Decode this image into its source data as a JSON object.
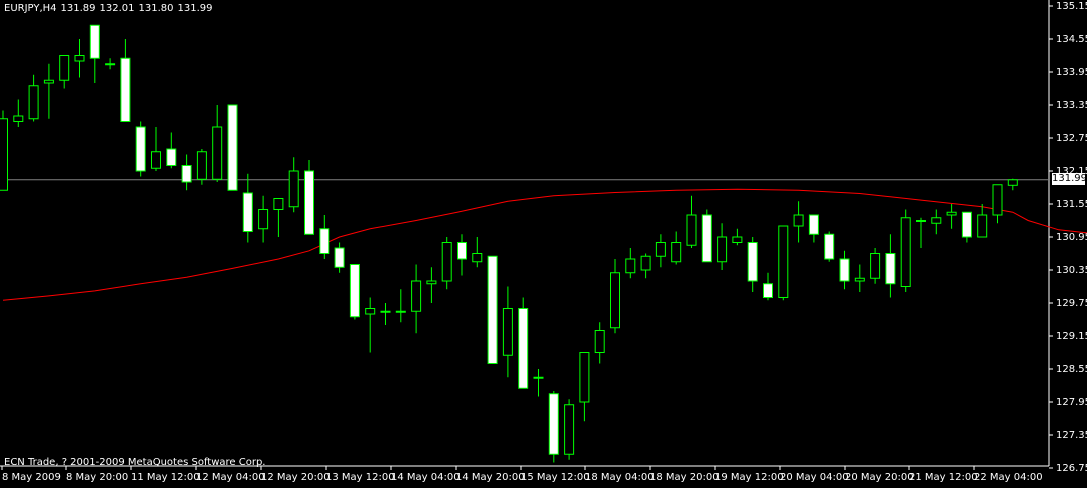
{
  "header": {
    "symbol": "EURJPY,H4",
    "open": "131.89",
    "high": "132.01",
    "low": "131.80",
    "close": "131.99"
  },
  "footer": {
    "copyright": "ECN Trade, ? 2001-2009 MetaQuotes Software Corp."
  },
  "current_price_label": "131.99",
  "colors": {
    "background": "#000000",
    "bull_candle": "#000000",
    "bear_candle": "#ffffff",
    "wick": "#00ff00",
    "moving_average": "#ff0000",
    "price_line": "#808080",
    "axis": "#ffffff"
  },
  "chart_data": {
    "type": "candlestick",
    "y_ticks": [
      "135.15",
      "134.55",
      "133.95",
      "133.35",
      "132.75",
      "132.15",
      "131.55",
      "130.95",
      "130.35",
      "129.75",
      "129.15",
      "128.55",
      "127.95",
      "127.35",
      "126.75"
    ],
    "x_ticks": [
      "8 May 2009",
      "8 May 20:00",
      "11 May 12:00",
      "12 May 04:00",
      "12 May 20:00",
      "13 May 12:00",
      "14 May 04:00",
      "14 May 20:00",
      "15 May 12:00",
      "18 May 04:00",
      "18 May 20:00",
      "19 May 12:00",
      "20 May 04:00",
      "20 May 20:00",
      "21 May 12:00",
      "22 May 04:00"
    ],
    "ylim": [
      126.75,
      135.15
    ],
    "current_price": 131.99,
    "candles": [
      {
        "o": 131.8,
        "h": 133.25,
        "l": 131.95,
        "c": 133.1
      },
      {
        "o": 133.05,
        "h": 133.45,
        "l": 132.95,
        "c": 133.15
      },
      {
        "o": 133.1,
        "h": 133.9,
        "l": 133.05,
        "c": 133.7
      },
      {
        "o": 133.75,
        "h": 134.1,
        "l": 133.1,
        "c": 133.8
      },
      {
        "o": 133.8,
        "h": 134.25,
        "l": 133.65,
        "c": 134.25
      },
      {
        "o": 134.15,
        "h": 134.55,
        "l": 133.85,
        "c": 134.25
      },
      {
        "o": 134.8,
        "h": 134.8,
        "l": 133.75,
        "c": 134.2
      },
      {
        "o": 134.1,
        "h": 134.2,
        "l": 134.0,
        "c": 134.1
      },
      {
        "o": 134.2,
        "h": 134.55,
        "l": 133.05,
        "c": 133.05
      },
      {
        "o": 132.95,
        "h": 133.05,
        "l": 132.05,
        "c": 132.15
      },
      {
        "o": 132.2,
        "h": 132.95,
        "l": 132.15,
        "c": 132.5
      },
      {
        "o": 132.55,
        "h": 132.85,
        "l": 132.2,
        "c": 132.25
      },
      {
        "o": 132.25,
        "h": 132.45,
        "l": 131.8,
        "c": 131.95
      },
      {
        "o": 132.0,
        "h": 132.55,
        "l": 131.9,
        "c": 132.5
      },
      {
        "o": 132.0,
        "h": 133.35,
        "l": 131.95,
        "c": 132.95
      },
      {
        "o": 133.35,
        "h": 133.35,
        "l": 131.8,
        "c": 131.8
      },
      {
        "o": 131.75,
        "h": 132.1,
        "l": 130.85,
        "c": 131.05
      },
      {
        "o": 131.1,
        "h": 131.7,
        "l": 130.85,
        "c": 131.45
      },
      {
        "o": 131.45,
        "h": 131.65,
        "l": 130.95,
        "c": 131.65
      },
      {
        "o": 131.5,
        "h": 132.4,
        "l": 131.4,
        "c": 132.15
      },
      {
        "o": 132.15,
        "h": 132.35,
        "l": 131.0,
        "c": 131.0
      },
      {
        "o": 131.1,
        "h": 131.35,
        "l": 130.55,
        "c": 130.65
      },
      {
        "o": 130.75,
        "h": 130.85,
        "l": 130.3,
        "c": 130.4
      },
      {
        "o": 130.45,
        "h": 130.45,
        "l": 129.45,
        "c": 129.5
      },
      {
        "o": 129.55,
        "h": 129.85,
        "l": 128.85,
        "c": 129.65
      },
      {
        "o": 129.6,
        "h": 129.75,
        "l": 129.35,
        "c": 129.6
      },
      {
        "o": 129.6,
        "h": 130.0,
        "l": 129.4,
        "c": 129.6
      },
      {
        "o": 129.6,
        "h": 130.45,
        "l": 129.2,
        "c": 130.15
      },
      {
        "o": 130.1,
        "h": 130.4,
        "l": 129.75,
        "c": 130.15
      },
      {
        "o": 130.15,
        "h": 130.95,
        "l": 130.0,
        "c": 130.85
      },
      {
        "o": 130.85,
        "h": 131.0,
        "l": 130.25,
        "c": 130.55
      },
      {
        "o": 130.5,
        "h": 130.95,
        "l": 130.4,
        "c": 130.65
      },
      {
        "o": 130.6,
        "h": 130.6,
        "l": 128.65,
        "c": 128.65
      },
      {
        "o": 128.8,
        "h": 130.05,
        "l": 128.4,
        "c": 129.65
      },
      {
        "o": 129.65,
        "h": 129.85,
        "l": 128.2,
        "c": 128.2
      },
      {
        "o": 128.4,
        "h": 128.55,
        "l": 128.05,
        "c": 128.4
      },
      {
        "o": 128.1,
        "h": 128.15,
        "l": 126.85,
        "c": 127.0
      },
      {
        "o": 127.0,
        "h": 128.0,
        "l": 126.9,
        "c": 127.9
      },
      {
        "o": 127.95,
        "h": 128.65,
        "l": 127.6,
        "c": 128.85
      },
      {
        "o": 128.85,
        "h": 129.4,
        "l": 128.65,
        "c": 129.25
      },
      {
        "o": 129.3,
        "h": 130.55,
        "l": 129.2,
        "c": 130.3
      },
      {
        "o": 130.3,
        "h": 130.75,
        "l": 130.2,
        "c": 130.55
      },
      {
        "o": 130.35,
        "h": 130.65,
        "l": 130.2,
        "c": 130.6
      },
      {
        "o": 130.6,
        "h": 131.0,
        "l": 130.4,
        "c": 130.85
      },
      {
        "o": 130.5,
        "h": 131.05,
        "l": 130.45,
        "c": 130.85
      },
      {
        "o": 130.8,
        "h": 131.7,
        "l": 130.75,
        "c": 131.35
      },
      {
        "o": 131.35,
        "h": 131.45,
        "l": 130.5,
        "c": 130.5
      },
      {
        "o": 130.5,
        "h": 131.2,
        "l": 130.35,
        "c": 130.95
      },
      {
        "o": 130.85,
        "h": 131.1,
        "l": 130.8,
        "c": 130.95
      },
      {
        "o": 130.85,
        "h": 130.95,
        "l": 129.95,
        "c": 130.15
      },
      {
        "o": 130.1,
        "h": 130.3,
        "l": 129.8,
        "c": 129.85
      },
      {
        "o": 129.85,
        "h": 131.15,
        "l": 129.8,
        "c": 131.15
      },
      {
        "o": 131.15,
        "h": 131.6,
        "l": 130.85,
        "c": 131.35
      },
      {
        "o": 131.35,
        "h": 131.35,
        "l": 130.85,
        "c": 131.0
      },
      {
        "o": 131.0,
        "h": 131.05,
        "l": 130.5,
        "c": 130.55
      },
      {
        "o": 130.55,
        "h": 130.7,
        "l": 130.0,
        "c": 130.15
      },
      {
        "o": 130.15,
        "h": 130.45,
        "l": 129.95,
        "c": 130.2
      },
      {
        "o": 130.2,
        "h": 130.75,
        "l": 130.1,
        "c": 130.65
      },
      {
        "o": 130.65,
        "h": 131.0,
        "l": 129.85,
        "c": 130.1
      },
      {
        "o": 130.05,
        "h": 131.45,
        "l": 129.95,
        "c": 131.3
      },
      {
        "o": 131.25,
        "h": 131.3,
        "l": 130.75,
        "c": 131.25
      },
      {
        "o": 131.2,
        "h": 131.45,
        "l": 131.0,
        "c": 131.3
      },
      {
        "o": 131.35,
        "h": 131.55,
        "l": 131.1,
        "c": 131.4
      },
      {
        "o": 131.4,
        "h": 131.4,
        "l": 130.85,
        "c": 130.95
      },
      {
        "o": 130.95,
        "h": 131.55,
        "l": 130.95,
        "c": 131.35
      },
      {
        "o": 131.35,
        "h": 131.9,
        "l": 131.2,
        "c": 131.9
      },
      {
        "o": 131.89,
        "h": 132.01,
        "l": 131.8,
        "c": 131.99
      }
    ],
    "moving_average": [
      [
        0,
        129.8
      ],
      [
        3,
        129.88
      ],
      [
        6,
        129.97
      ],
      [
        9,
        130.1
      ],
      [
        12,
        130.22
      ],
      [
        15,
        130.38
      ],
      [
        18,
        130.55
      ],
      [
        20,
        130.7
      ],
      [
        22,
        130.95
      ],
      [
        24,
        131.1
      ],
      [
        27,
        131.25
      ],
      [
        30,
        131.42
      ],
      [
        33,
        131.6
      ],
      [
        36,
        131.7
      ],
      [
        40,
        131.76
      ],
      [
        44,
        131.8
      ],
      [
        48,
        131.82
      ],
      [
        52,
        131.8
      ],
      [
        56,
        131.74
      ],
      [
        60,
        131.62
      ],
      [
        64,
        131.5
      ],
      [
        66,
        131.4
      ],
      [
        67,
        131.25
      ],
      [
        69,
        131.08
      ],
      [
        71,
        131.02
      ],
      [
        73,
        131.0
      ],
      [
        75,
        130.98
      ]
    ]
  }
}
